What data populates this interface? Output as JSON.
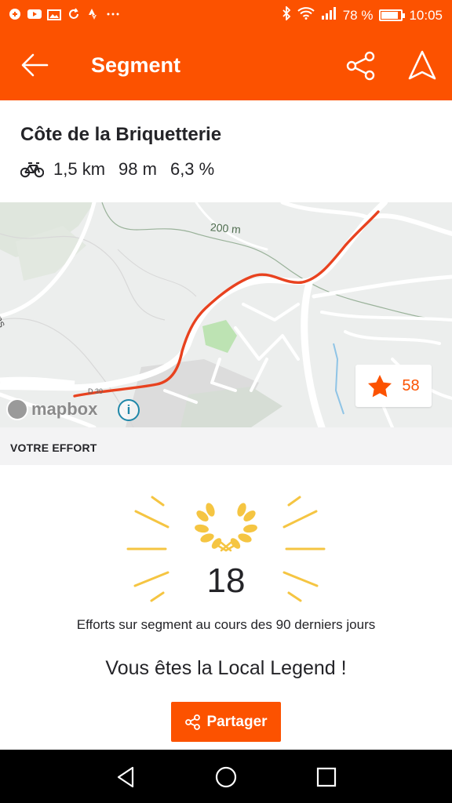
{
  "status_bar": {
    "battery_percent_text": "78 %",
    "battery_level": 0.78,
    "time": "10:05",
    "left_icons": [
      "notification-icon",
      "youtube-icon",
      "gallery-icon",
      "sync-icon",
      "strava-icon",
      "more-icon"
    ],
    "right_icons": [
      "bluetooth-icon",
      "wifi-icon",
      "signal-icon",
      "battery-icon"
    ]
  },
  "app_bar": {
    "title": "Segment",
    "back_icon": "arrow-left-icon",
    "share_icon": "share-icon",
    "navigate_icon": "navigation-icon"
  },
  "segment": {
    "name": "Côte de la Briquetterie",
    "activity_icon": "bike-icon",
    "distance": "1,5 km",
    "elevation": "98 m",
    "grade": "6,3 %"
  },
  "map": {
    "contour_label": "200 m",
    "place_label": "balens",
    "road_label": "D 30",
    "attribution": "mapbox",
    "star_count": "58",
    "route_color": "#e8421f"
  },
  "effort": {
    "section_label": "VOTRE EFFORT",
    "count": "18",
    "description": "Efforts sur segment au cours des 90 derniers jours",
    "legend_message": "Vous êtes la Local Legend !",
    "share_label": "Partager"
  },
  "colors": {
    "brand": "#fc5200",
    "laurel": "#f5c542"
  }
}
